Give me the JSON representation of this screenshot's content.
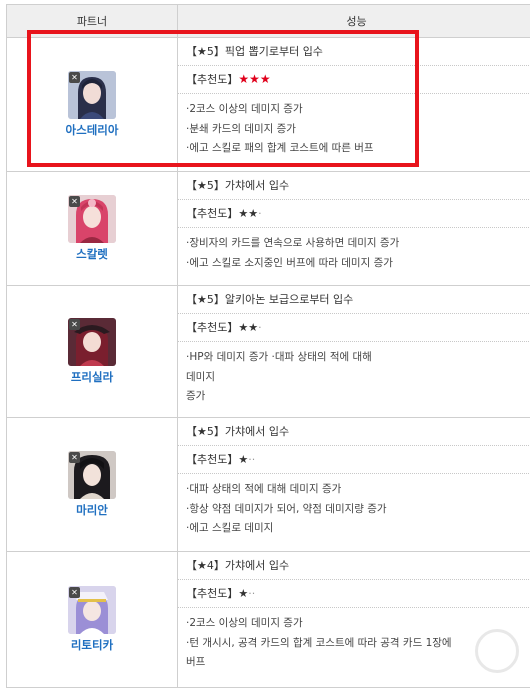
{
  "header": {
    "partner": "파트너",
    "performance": "성능"
  },
  "rows": [
    {
      "name": "아스테리아",
      "source": "【★5】픽업 뽑기로부터 입수",
      "rec_label": "【추천도】",
      "rec_stars": "★★★",
      "effects": [
        "·2코스 이상의 데미지 증가",
        "·분쇄 카드의 데미지 증가",
        "·에고 스킬로 패의 합계 코스트에 따른 버프"
      ]
    },
    {
      "name": "스칼렛",
      "source": "【★5】가챠에서 입수",
      "rec_label": "【추천도】",
      "rec_stars": "★★",
      "rec_dots": "·",
      "effects": [
        "·장비자의 카드를 연속으로 사용하면 데미지 증가",
        "·에고 스킬로 소지중인 버프에 따라 데미지 증가"
      ]
    },
    {
      "name": "프리실라",
      "source": "【★5】알키아논 보급으로부터 입수",
      "rec_label": "【추천도】",
      "rec_stars": "★★",
      "rec_dots": "·",
      "effects": [
        "·HP와 데미지 증가 ·대파 상태의 적에 대해",
        "데미지",
        "증가"
      ]
    },
    {
      "name": "마리안",
      "source": "【★5】가챠에서 입수",
      "rec_label": "【추천도】",
      "rec_stars": "★",
      "rec_dots": "··",
      "effects": [
        "·대파 상태의 적에 대해 데미지 증가",
        "·항상 약점 데미지가 되어, 약점 데미지량 증가",
        "·에고 스킬로 데미지"
      ]
    },
    {
      "name": "리토티카",
      "source": "【★4】가챠에서 입수",
      "rec_label": "【추천도】",
      "rec_stars": "★",
      "rec_dots": "··",
      "effects": [
        "·2코스 이상의 데미지 증가",
        "·턴 개시시, 공격 카드의 합계 코스트에 따라 공격 카드 1장에",
        "버프"
      ]
    }
  ],
  "colors": {
    "highlight": "#e8141c",
    "name_blue": "#1f6fc0",
    "star_red": "#e0001b"
  }
}
